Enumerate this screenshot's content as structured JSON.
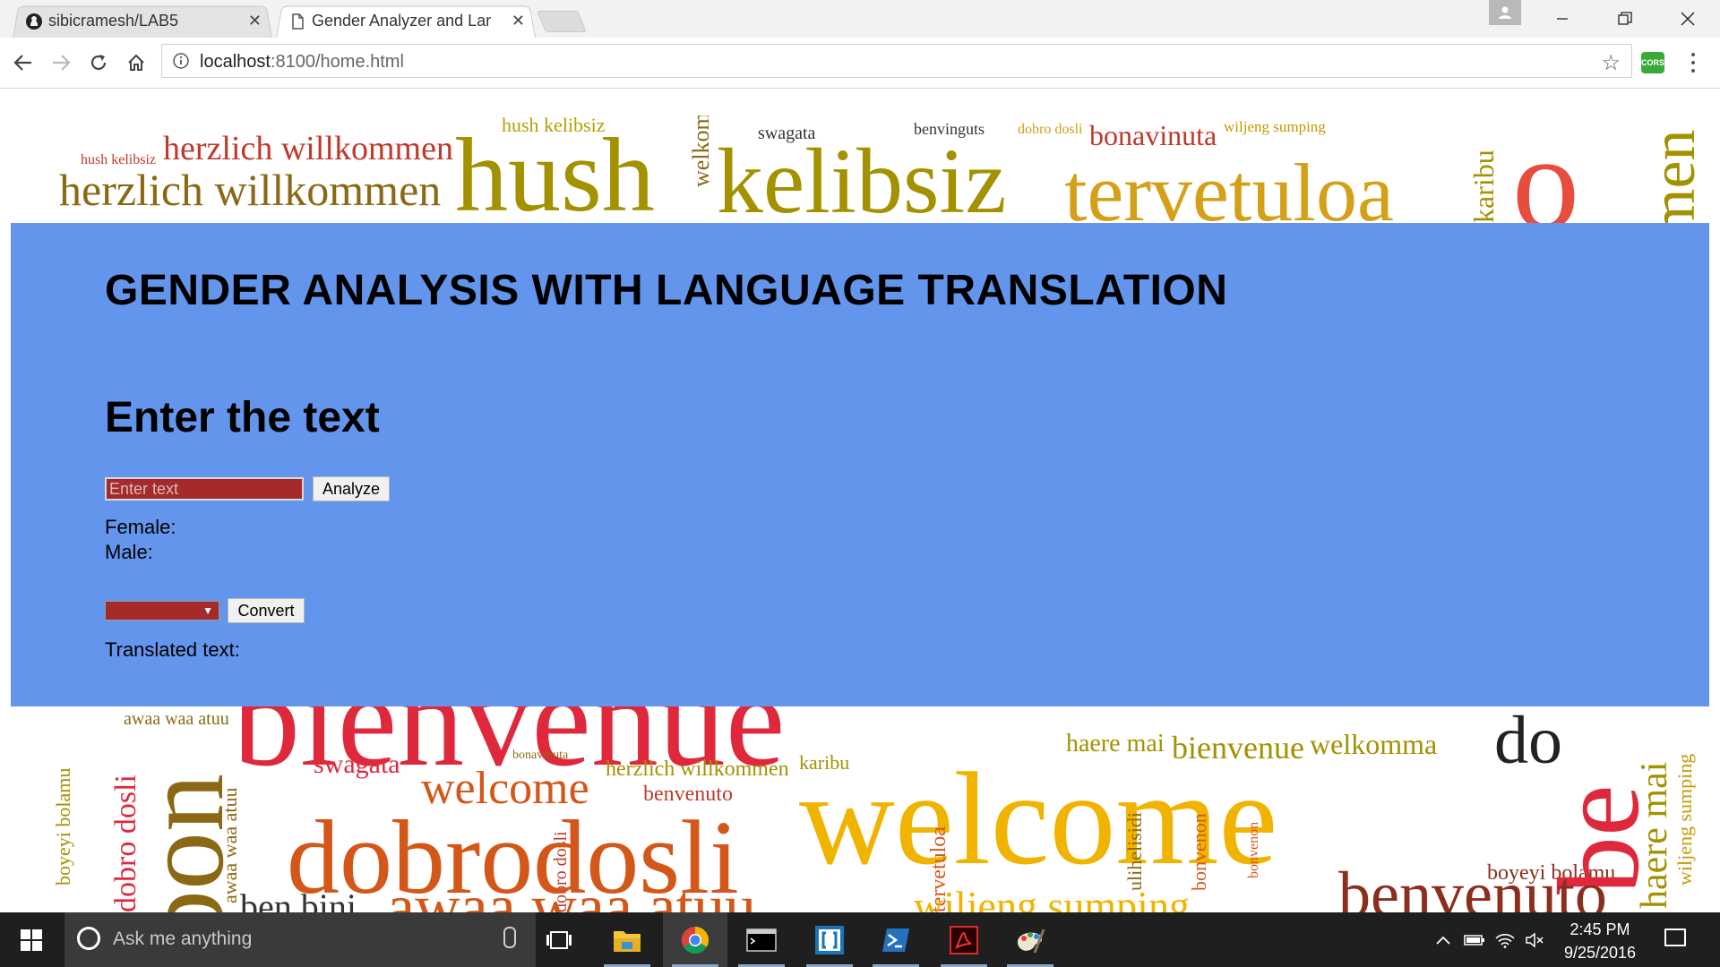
{
  "browser": {
    "tabs": [
      {
        "title": "sibicramesh/LAB5",
        "icon": "github-icon",
        "active": false
      },
      {
        "title": "Gender Analyzer and Lan",
        "icon": "page-icon",
        "active": true
      }
    ],
    "url_host": "localhost",
    "url_rest": ":8100/home.html",
    "extension_label": "CORS"
  },
  "page": {
    "title": "GENDER ANALYSIS WITH LANGUAGE TRANSLATION",
    "subtitle": "Enter the text",
    "input_placeholder": "Enter text",
    "analyze_label": "Analyze",
    "female_label": "Female:",
    "male_label": "Male:",
    "convert_label": "Convert",
    "translated_label": "Translated text:",
    "panel_color": "#6495ed",
    "control_color": "#a52a2a"
  },
  "wordcloud": {
    "top": [
      "hush kelibsiz",
      "herzlich willkommen",
      "herzlich willkommen",
      "hush",
      "hush kelibsiz",
      "welkom",
      "swagata",
      "kelibsiz",
      "benvinguts",
      "dobro dosli",
      "bonavinuta",
      "wiljeng sumping",
      "tervetuloa",
      "karibu",
      "o",
      "men"
    ],
    "bottom": [
      "awaa waa atuu",
      "bienvenue",
      "haere mai",
      "bienvenue",
      "welkomma",
      "do",
      "boyeyi bolamu",
      "dobro dosli",
      "awaa waa atuu",
      "swagata",
      "bonavinuta",
      "welcome",
      "herzlich willkommen",
      "benvenuto",
      "karibu",
      "dobro dosli",
      "dobrodosli",
      "welcome",
      "tervetuloa",
      "ulihelisidi",
      "bonvenon",
      "bonvenon",
      "be",
      "haere mai",
      "wiljeng sumping",
      "boyeyi bolamu",
      "bon",
      "ben bini",
      "awaa waa atuu",
      "wiljeng sumping",
      "benvenuto"
    ]
  },
  "taskbar": {
    "search_placeholder": "Ask me anything",
    "time": "2:45 PM",
    "date": "9/25/2016",
    "apps": [
      "task-view-icon",
      "file-explorer-icon",
      "chrome-icon",
      "cmd-icon",
      "brackets-icon",
      "powershell-icon",
      "acrobat-icon",
      "paint-icon"
    ]
  }
}
